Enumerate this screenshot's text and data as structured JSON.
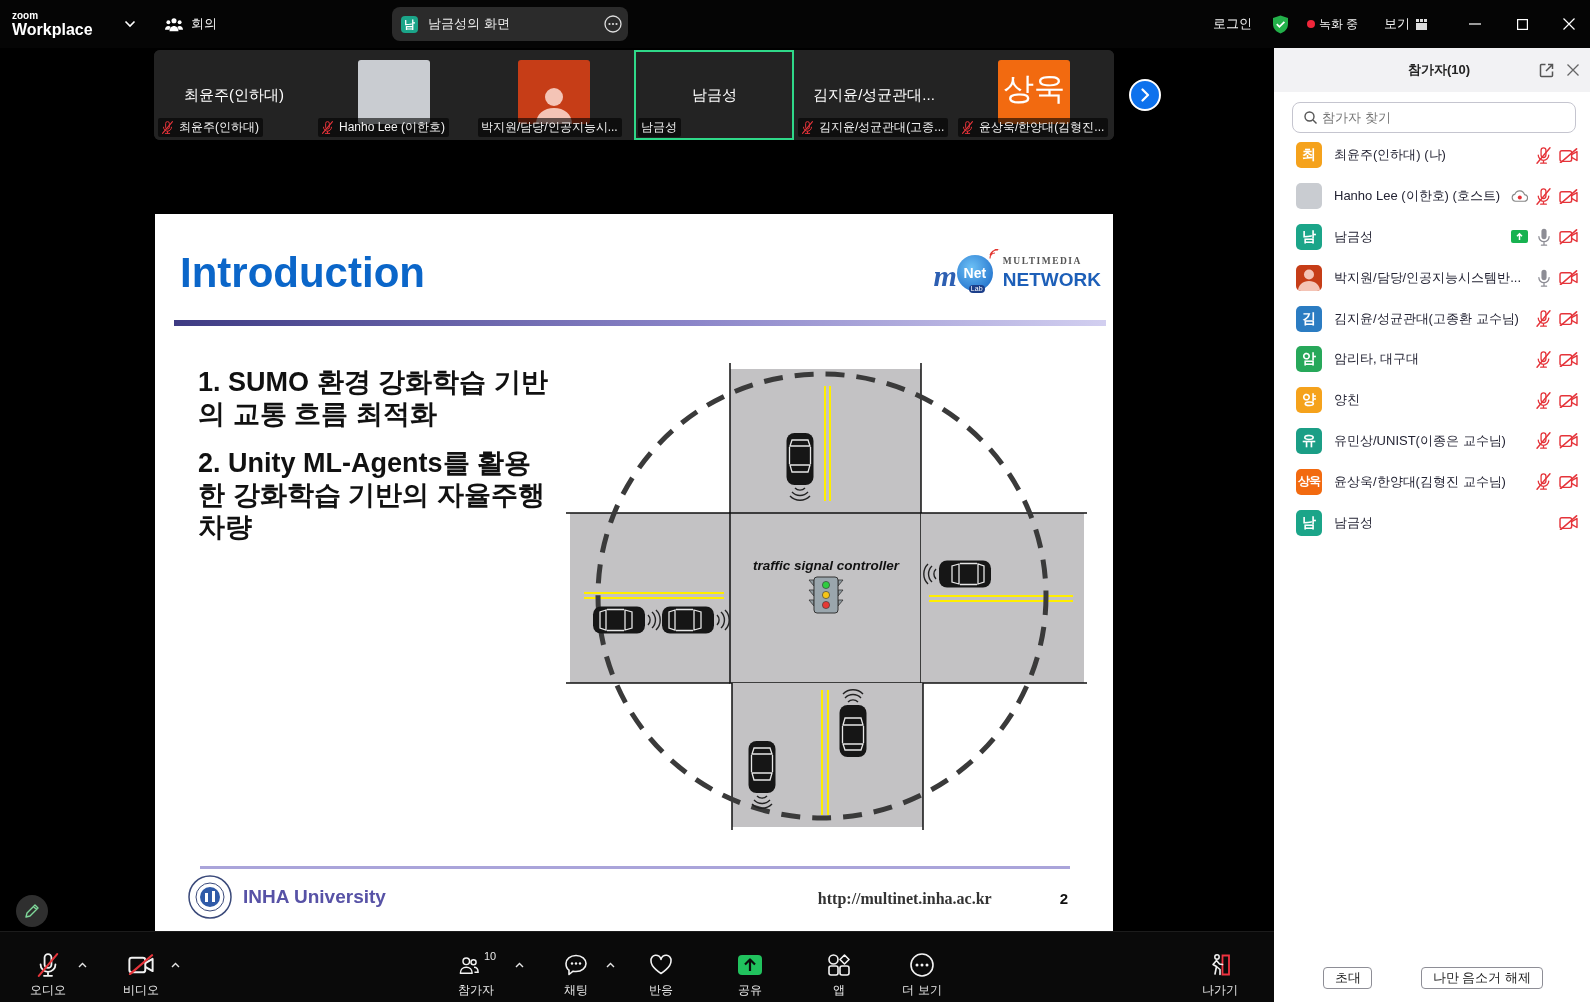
{
  "top_bar": {
    "logo": {
      "small": "zoom",
      "main": "Workplace"
    },
    "meeting_menu": "회의",
    "share_pill": {
      "avatar": "남",
      "color": "#1ba589",
      "label": "남금성의 화면"
    },
    "login": "로그인",
    "recording": "녹화 중",
    "view": "보기"
  },
  "thumbnails": [
    {
      "kind": "name",
      "display": "최윤주(인하대)",
      "label": "최윤주(인하대)",
      "muted": true,
      "speaking": false
    },
    {
      "kind": "photo",
      "label": "Hanho Lee (이한호)",
      "muted": true,
      "speaking": false
    },
    {
      "kind": "avatar",
      "color": "#c63d17",
      "label": "박지원/담당/인공지능시...",
      "muted": false,
      "speaking": false
    },
    {
      "kind": "name",
      "display": "남금성",
      "label": "남금성",
      "muted": false,
      "speaking": true
    },
    {
      "kind": "name",
      "display": "김지윤/성균관대...",
      "label": "김지윤/성균관대(고종...",
      "muted": true,
      "speaking": false
    },
    {
      "kind": "initials",
      "display": "상욱",
      "color": "#f26a10",
      "label": "윤상욱/한양대(김형진...",
      "muted": true,
      "speaking": false
    }
  ],
  "slide": {
    "title": "Introduction",
    "logo": {
      "script": "m",
      "badge": "Net",
      "tag": "Lab",
      "subtitle": "MULTIMEDIA",
      "wordmark": "NETWORK"
    },
    "bullets": [
      "1. SUMO 환경 강화학습 기반의 교통 흐름 최적화",
      "2. Unity ML-Agents를 활용한 강화학습 기반의 자율주행 차량"
    ],
    "diagram": {
      "label": "traffic signal controller"
    },
    "footer": {
      "university": "INHA University",
      "url": "http://multinet.inha.ac.kr",
      "page": "2"
    }
  },
  "toolbar": [
    {
      "kind": "audio",
      "label": "오디오",
      "muted": true,
      "has_menu": true
    },
    {
      "kind": "video",
      "label": "비디오",
      "stopped": true,
      "has_menu": true
    },
    {
      "kind": "participants",
      "label": "참가자",
      "count": "10",
      "has_menu": true
    },
    {
      "kind": "chat",
      "label": "채팅",
      "has_menu": true
    },
    {
      "kind": "reactions",
      "label": "반응"
    },
    {
      "kind": "share",
      "label": "공유"
    },
    {
      "kind": "apps",
      "label": "앱"
    },
    {
      "kind": "more",
      "label": "더 보기"
    },
    {
      "kind": "leave",
      "label": "나가기"
    }
  ],
  "participants_panel": {
    "title": "참가자(10)",
    "search": {
      "placeholder": "참가자 찾기"
    },
    "participants": [
      {
        "name": "최윤주(인하대) (나)",
        "avatar": {
          "kind": "initials",
          "text": "최",
          "color": "#f5a21c"
        },
        "muted": true,
        "video_off": true
      },
      {
        "name": "Hanho Lee (이한호) (호스트)",
        "avatar": {
          "kind": "photo"
        },
        "recording": true,
        "muted": true,
        "video_off": true
      },
      {
        "name": "남금성",
        "avatar": {
          "kind": "initials",
          "text": "남",
          "color": "#1ba589"
        },
        "sharing": true,
        "muted": false,
        "video_off": true
      },
      {
        "name": "박지원/담당/인공지능시스템반...",
        "avatar": {
          "kind": "silhouette",
          "color": "#c63d17"
        },
        "muted": false,
        "video_off": true
      },
      {
        "name": "김지윤/성균관대(고종환 교수님)",
        "avatar": {
          "kind": "initials",
          "text": "김",
          "color": "#2b7cc2"
        },
        "muted": true,
        "video_off": true
      },
      {
        "name": "암리타, 대구대",
        "avatar": {
          "kind": "initials",
          "text": "암",
          "color": "#27a85a"
        },
        "muted": true,
        "video_off": true
      },
      {
        "name": "양친",
        "avatar": {
          "kind": "initials",
          "text": "양",
          "color": "#f5a21c"
        },
        "muted": true,
        "video_off": true
      },
      {
        "name": "유민상/UNIST(이종은 교수님)",
        "avatar": {
          "kind": "initials",
          "text": "유",
          "color": "#1b9e86"
        },
        "muted": true,
        "video_off": true
      },
      {
        "name": "윤상욱/한양대(김형진 교수님)",
        "avatar": {
          "kind": "initials",
          "text": "상욱",
          "color": "#f26a10"
        },
        "muted": true,
        "video_off": true
      },
      {
        "name": "남금성",
        "avatar": {
          "kind": "initials",
          "text": "남",
          "color": "#1ba589"
        },
        "video_off": true
      }
    ],
    "buttons": [
      "초대",
      "나만 음소거 해제"
    ]
  }
}
